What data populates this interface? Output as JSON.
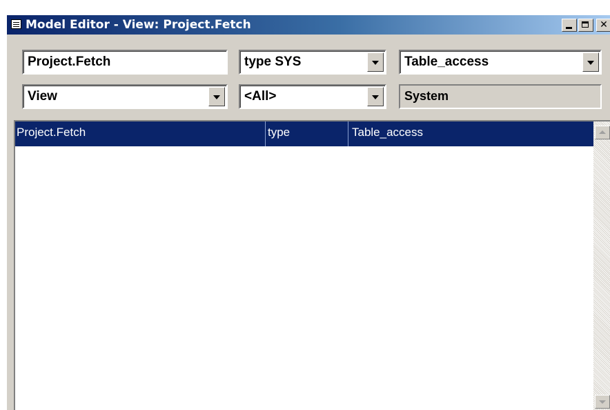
{
  "window": {
    "title": "Model Editor - View: Project.Fetch",
    "icon": "grid-icon",
    "controls": [
      "minimize",
      "maximize",
      "close"
    ]
  },
  "filters": {
    "name_value": "Project.Fetch",
    "type_value": "type SYS",
    "access_value": "Table_access",
    "kind_value": "View",
    "scope_value": "<All>",
    "owner_value": "System"
  },
  "list": {
    "rows": [
      {
        "name": "Project.Fetch",
        "type": "type",
        "access": "Table_access",
        "selected": true
      }
    ]
  },
  "colors": {
    "title_start": "#0a246a",
    "title_end": "#a6caf0",
    "selection": "#0a246a",
    "face": "#d4d0c8"
  }
}
